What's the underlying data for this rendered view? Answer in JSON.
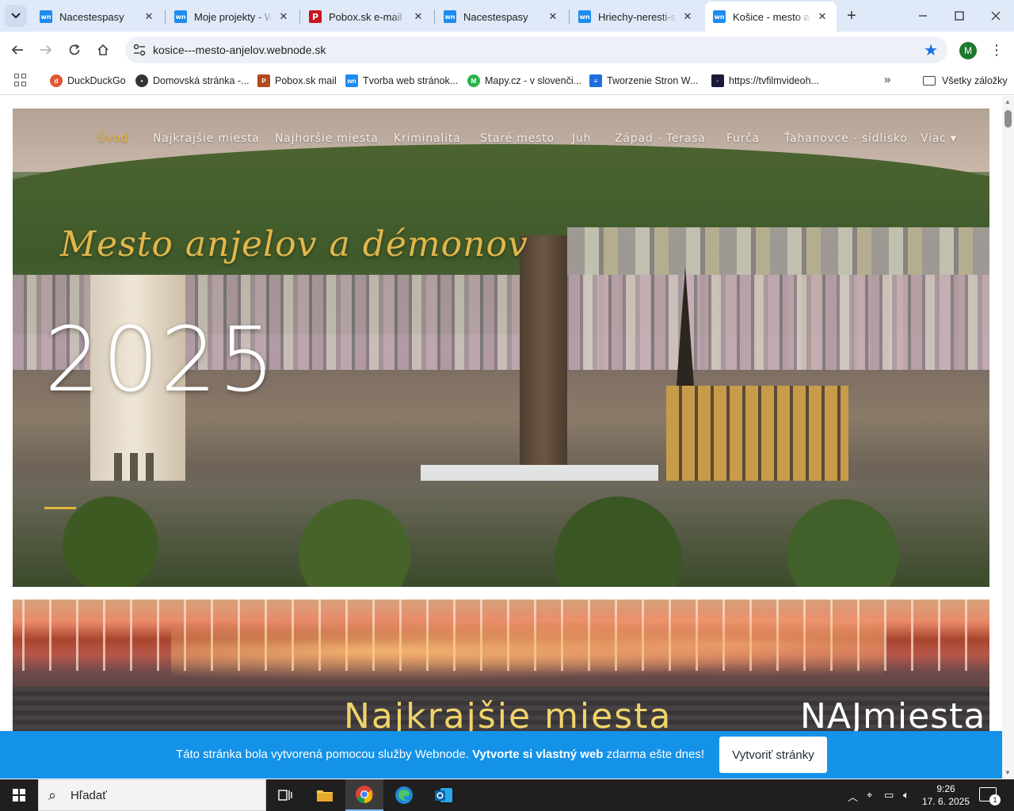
{
  "browser": {
    "tabs": [
      {
        "title": "Nacestespasy",
        "favicon": "wn",
        "active": false
      },
      {
        "title": "Moje projekty - Webnode",
        "favicon": "wn",
        "active": false
      },
      {
        "title": "Pobox.sk e-mail – pošta",
        "favicon": "pobox",
        "active": false
      },
      {
        "title": "Nacestespasy",
        "favicon": "wn",
        "active": false
      },
      {
        "title": "Hriechy-neresti-svetla",
        "favicon": "wn",
        "active": false
      },
      {
        "title": "Košice - mesto anjelov",
        "favicon": "wn",
        "active": true
      }
    ],
    "url": "kosice---mesto-anjelov.webnode.sk",
    "profile_initial": "M",
    "accent_color": "#1a6fe0"
  },
  "bookmarks": {
    "items": [
      {
        "label": "DuckDuckGo",
        "color": "#de5833"
      },
      {
        "label": "Domovská stránka -...",
        "color": "#333333"
      },
      {
        "label": "Pobox.sk mail",
        "color": "#b5481d"
      },
      {
        "label": "Tvorba web stránok...",
        "color": "#1d8cf0"
      },
      {
        "label": "Mapy.cz - v slovenči...",
        "color": "#2bb24c"
      },
      {
        "label": "Tworzenie Stron W...",
        "color": "#1d6fe0"
      },
      {
        "label": "https://tvfilmvideoh...",
        "color": "#1a1a3a"
      }
    ],
    "more": "»",
    "all_label": "Všetky záložky"
  },
  "site": {
    "nav": [
      {
        "label": "Úvod",
        "active": true
      },
      {
        "label": "Najkrajšie miesta",
        "active": false
      },
      {
        "label": "Najhoršie miesta",
        "active": false
      },
      {
        "label": "Kriminalita",
        "active": false
      },
      {
        "label": "Staré mesto",
        "active": false
      },
      {
        "label": "Juh",
        "active": false
      },
      {
        "label": "Západ - Terasa",
        "active": false
      },
      {
        "label": "Furča",
        "active": false
      },
      {
        "label": "Ťahanovce - sídlisko",
        "active": false
      },
      {
        "label": "Viac",
        "active": false
      }
    ],
    "hero_title": "Mesto anjelov a démonov",
    "hero_year": "2025",
    "section_title": "Najkrajšie miesta",
    "section_logo": "NAJmiesta",
    "accent_color": "#e1b53f"
  },
  "webnode_bar": {
    "text_before": "Táto stránka bola vytvorená pomocou služby Webnode. ",
    "text_bold": "Vytvorte si vlastný web",
    "text_after": " zdarma ešte dnes!",
    "button_label": "Vytvoriť stránky",
    "color": "#1492e8"
  },
  "taskbar": {
    "search_placeholder": "Hľadať",
    "time": "9:26",
    "date": "17. 6. 2025",
    "notification_count": "1"
  }
}
